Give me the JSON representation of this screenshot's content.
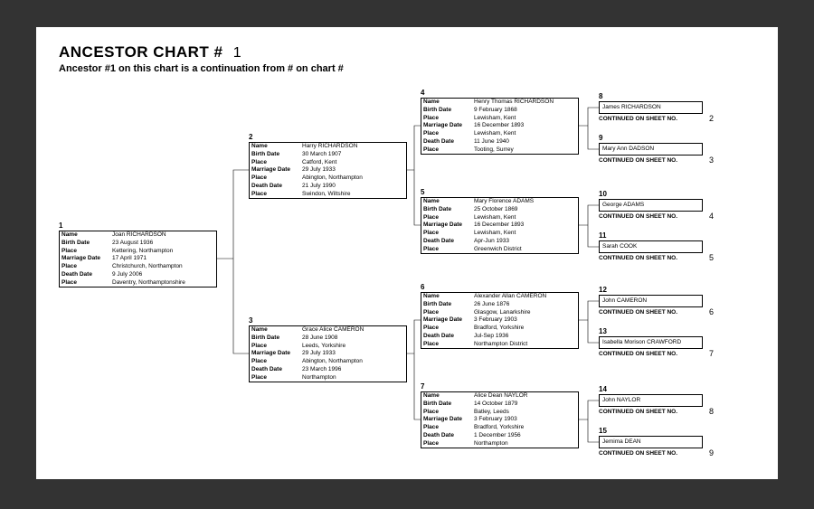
{
  "header": {
    "titlePrefix": "ANCESTOR CHART #",
    "chartNum": "1",
    "subtitle": "Ancestor #1 on this chart is a continuation from #    on chart #"
  },
  "labels": {
    "name": "Name",
    "birthDate": "Birth Date",
    "place": "Place",
    "marriageDate": "Marriage Date",
    "deathDate": "Death Date",
    "continued": "CONTINUED ON SHEET NO."
  },
  "p1": {
    "num": "1",
    "name": "Joan RICHARDSON",
    "bd": "23 August 1936",
    "bp": "Kettering, Northampton",
    "md": "17 April 1971",
    "mp": "Christchurch, Northampton",
    "dd": "9 July 2006",
    "dp": "Daventry, Northamptonshire"
  },
  "p2": {
    "num": "2",
    "name": "Harry RICHARDSON",
    "bd": "30 March 1907",
    "bp": "Catford, Kent",
    "md": "29 July 1933",
    "mp": "Abington, Northampton",
    "dd": "21 July 1990",
    "dp": "Swindon, Wiltshire"
  },
  "p3": {
    "num": "3",
    "name": "Grace Alice CAMERON",
    "bd": "28 June 1908",
    "bp": "Leeds, Yorkshire",
    "md": "29 July 1933",
    "mp": "Abington, Northampton",
    "dd": "23 March 1996",
    "dp": "Northampton"
  },
  "p4": {
    "num": "4",
    "name": "Henry Thomas RICHARDSON",
    "bd": "9 February 1868",
    "bp": "Lewisham, Kent",
    "md": "16 December 1893",
    "mp": "Lewisham, Kent",
    "dd": "11 June 1940",
    "dp": "Tooting, Surrey"
  },
  "p5": {
    "num": "5",
    "name": "Mary Florence ADAMS",
    "bd": "25 October 1869",
    "bp": "Lewisham, Kent",
    "md": "16 December 1893",
    "mp": "Lewisham, Kent",
    "dd": "Apr-Jun 1933",
    "dp": "Greenwich District"
  },
  "p6": {
    "num": "6",
    "name": "Alexander Allan CAMERON",
    "bd": "26 June 1876",
    "bp": "Glasgow, Lanarkshire",
    "md": "3 February 1903",
    "mp": "Bradford, Yorkshire",
    "dd": "Jul-Sep 1936",
    "dp": "Northampton District"
  },
  "p7": {
    "num": "7",
    "name": "Alice Dean NAYLOR",
    "bd": "14 October 1879",
    "bp": "Batley, Leeds",
    "md": "3 February 1903",
    "mp": "Bradford, Yorkshire",
    "dd": "1 December 1956",
    "dp": "Northampton"
  },
  "g8": {
    "num": "8",
    "name": "James RICHARDSON",
    "sheet": "2"
  },
  "g9": {
    "num": "9",
    "name": "Mary Ann DADSON",
    "sheet": "3"
  },
  "g10": {
    "num": "10",
    "name": "George ADAMS",
    "sheet": "4"
  },
  "g11": {
    "num": "11",
    "name": "Sarah COOK",
    "sheet": "5"
  },
  "g12": {
    "num": "12",
    "name": "John CAMERON",
    "sheet": "6"
  },
  "g13": {
    "num": "13",
    "name": "Isabella Morison CRAWFORD",
    "sheet": "7"
  },
  "g14": {
    "num": "14",
    "name": "John NAYLOR",
    "sheet": "8"
  },
  "g15": {
    "num": "15",
    "name": "Jemima DEAN",
    "sheet": "9"
  }
}
